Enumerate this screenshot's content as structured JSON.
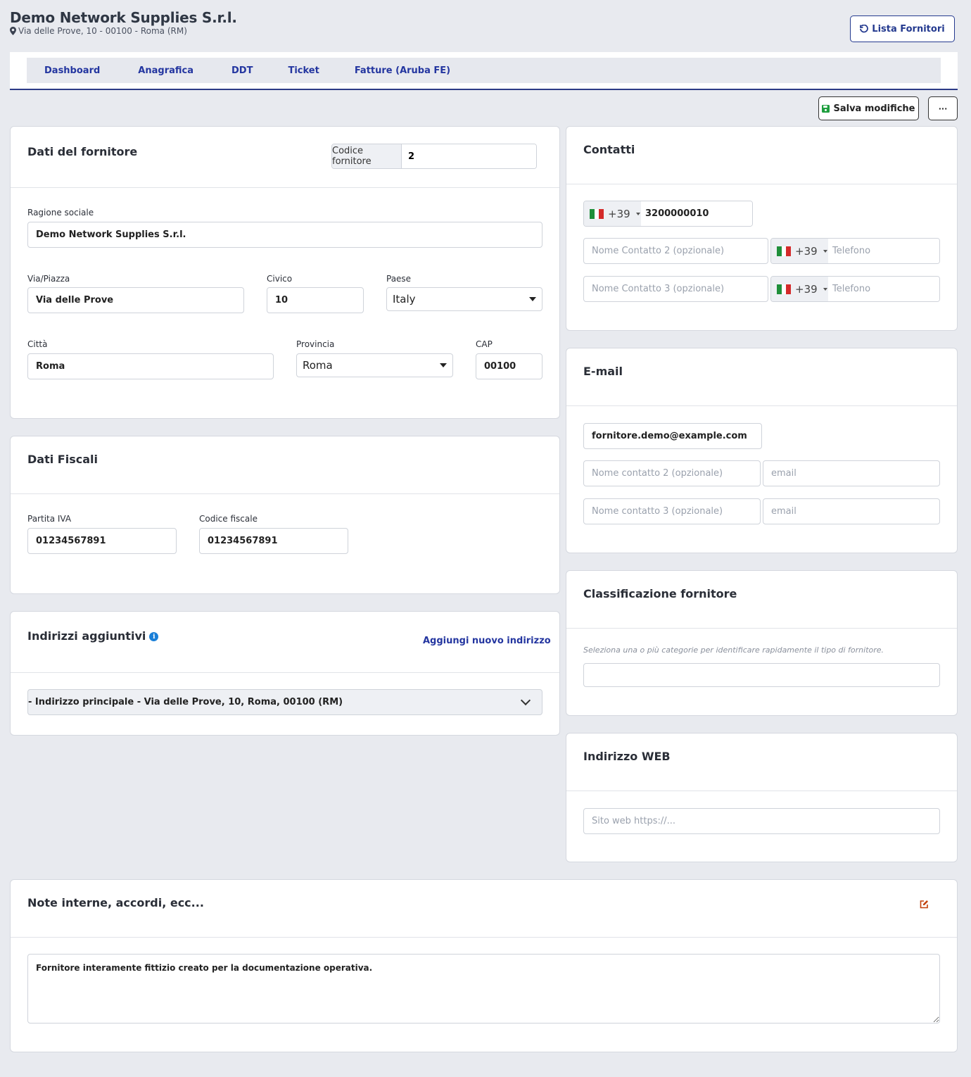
{
  "header": {
    "title": "Demo Network Supplies S.r.l.",
    "address": "Via delle Prove, 10 - 00100 - Roma (RM)",
    "back_button": "Lista Fornitori"
  },
  "tabs": [
    "Dashboard",
    "Anagrafica",
    "DDT",
    "Ticket",
    "Fatture (Aruba FE)"
  ],
  "toolbar": {
    "save_label": "Salva modifiche",
    "more_label": "···"
  },
  "supplier": {
    "title": "Dati del fornitore",
    "code_label": "Codice fornitore",
    "code_value": "2",
    "ragione_label": "Ragione sociale",
    "ragione_value": "Demo Network Supplies S.r.l.",
    "via_label": "Via/Piazza",
    "via_value": "Via delle Prove",
    "civico_label": "Civico",
    "civico_value": "10",
    "paese_label": "Paese",
    "paese_value": "Italy",
    "citta_label": "Città",
    "citta_value": "Roma",
    "provincia_label": "Provincia",
    "provincia_value": "Roma",
    "cap_label": "CAP",
    "cap_value": "00100"
  },
  "fiscal": {
    "title": "Dati Fiscali",
    "piva_label": "Partita IVA",
    "piva_value": "01234567891",
    "cf_label": "Codice fiscale",
    "cf_value": "01234567891"
  },
  "addresses": {
    "title": "Indirizzi aggiuntivi",
    "add_link": "Aggiungi nuovo indirizzo",
    "main_address": "- Indirizzo principale - Via delle Prove, 10, Roma, 00100 (RM)"
  },
  "contacts": {
    "title": "Contatti",
    "prefix": "+39",
    "phone1": "3200000010",
    "name2_placeholder": "Nome Contatto 2 (opzionale)",
    "name3_placeholder": "Nome Contatto 3 (opzionale)",
    "phone_placeholder": "Telefono"
  },
  "email": {
    "title": "E-mail",
    "email1": "fornitore.demo@example.com",
    "name2_placeholder": "Nome contatto 2 (opzionale)",
    "name3_placeholder": "Nome contatto 3 (opzionale)",
    "email_placeholder": "email"
  },
  "classification": {
    "title": "Classificazione fornitore",
    "hint": "Seleziona una o più categorie per identificare rapidamente il tipo di fornitore."
  },
  "web": {
    "title": "Indirizzo WEB",
    "placeholder": "Sito web https://..."
  },
  "notes": {
    "title": "Note interne, accordi, ecc...",
    "value": "Fornitore interamente fittizio creato per la documentazione operativa."
  },
  "colors": {
    "primary": "#2436a0",
    "save_icon": "#1e9e3e",
    "edit_icon": "#c2410c",
    "info": "#1a7fd8"
  }
}
